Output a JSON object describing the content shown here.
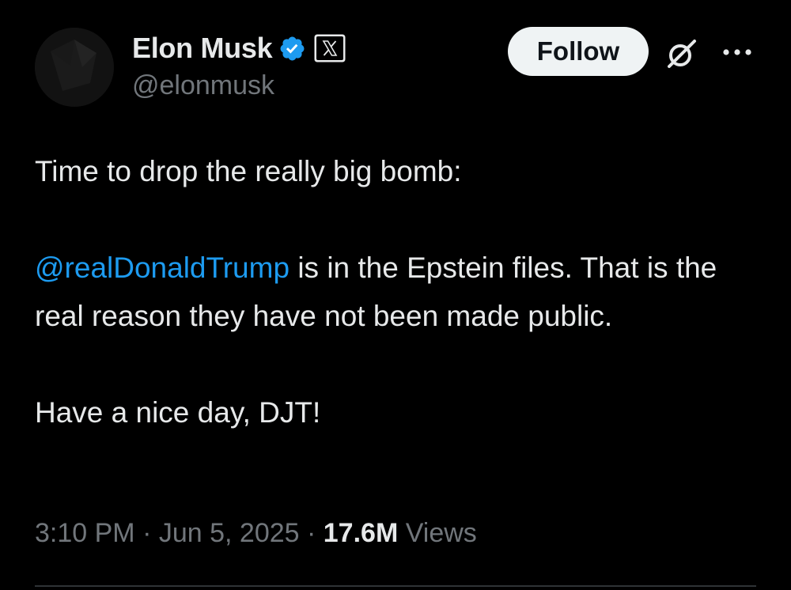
{
  "author": {
    "display_name": "Elon Musk",
    "handle": "@elonmusk",
    "verified": true,
    "affiliation_badge": "x-logo-icon"
  },
  "header": {
    "follow_label": "Follow",
    "grok_icon": "grok-icon",
    "more_icon": "more-options-icon"
  },
  "tweet": {
    "line1": "Time to drop the really big bomb:",
    "mention": "@realDonaldTrump",
    "paragraph2_rest": " is in the Epstein files. That is the real reason they have not been made public.",
    "line3": "Have a nice day, DJT!"
  },
  "meta": {
    "time": "3:10 PM",
    "date": "Jun 5, 2025",
    "separator": " · ",
    "views_count": "17.6M",
    "views_label": " Views"
  },
  "colors": {
    "background": "#000000",
    "text_primary": "#e7e9ea",
    "text_secondary": "#71767b",
    "link": "#1d9bf0",
    "verified_badge": "#1d9bf0",
    "follow_button_bg": "#eff3f4"
  }
}
